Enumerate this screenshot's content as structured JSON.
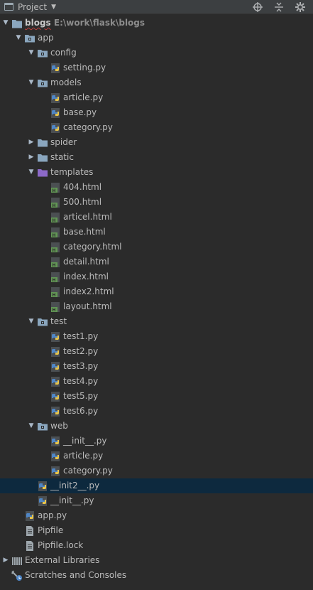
{
  "window": {
    "title": "Project"
  },
  "toolbar": {
    "icons": [
      "target-icon",
      "collapse-icon",
      "gear-icon"
    ]
  },
  "colors": {
    "background": "#2b2b2b",
    "header": "#3c3f41",
    "selected_row": "#0d293e",
    "folder": "#8aa6be",
    "python_blue": "#4f86c6",
    "python_yellow": "#e8c44a",
    "html_green": "#629755",
    "templates_folder": "#8c69c8"
  },
  "tree": [
    {
      "label": "blogs",
      "path": "E:\\work\\flask\\blogs",
      "depth": 0,
      "type": "root",
      "expanded": true
    },
    {
      "label": "app",
      "depth": 1,
      "type": "pkg",
      "expanded": true
    },
    {
      "label": "config",
      "depth": 2,
      "type": "pkg",
      "expanded": true
    },
    {
      "label": "setting.py",
      "depth": 3,
      "type": "py"
    },
    {
      "label": "models",
      "depth": 2,
      "type": "pkg",
      "expanded": true
    },
    {
      "label": "article.py",
      "depth": 3,
      "type": "py"
    },
    {
      "label": "base.py",
      "depth": 3,
      "type": "py"
    },
    {
      "label": "category.py",
      "depth": 3,
      "type": "py"
    },
    {
      "label": "spider",
      "depth": 2,
      "type": "folder",
      "expanded": false
    },
    {
      "label": "static",
      "depth": 2,
      "type": "folder",
      "expanded": false
    },
    {
      "label": "templates",
      "depth": 2,
      "type": "tplfolder",
      "expanded": true
    },
    {
      "label": "404.html",
      "depth": 3,
      "type": "html"
    },
    {
      "label": "500.html",
      "depth": 3,
      "type": "html"
    },
    {
      "label": "articel.html",
      "depth": 3,
      "type": "html"
    },
    {
      "label": "base.html",
      "depth": 3,
      "type": "html"
    },
    {
      "label": "category.html",
      "depth": 3,
      "type": "html"
    },
    {
      "label": "detail.html",
      "depth": 3,
      "type": "html"
    },
    {
      "label": "index.html",
      "depth": 3,
      "type": "html"
    },
    {
      "label": "index2.html",
      "depth": 3,
      "type": "html"
    },
    {
      "label": "layout.html",
      "depth": 3,
      "type": "html"
    },
    {
      "label": "test",
      "depth": 2,
      "type": "pkg",
      "expanded": true
    },
    {
      "label": "test1.py",
      "depth": 3,
      "type": "py"
    },
    {
      "label": "test2.py",
      "depth": 3,
      "type": "py"
    },
    {
      "label": "test3.py",
      "depth": 3,
      "type": "py"
    },
    {
      "label": "test4.py",
      "depth": 3,
      "type": "py"
    },
    {
      "label": "test5.py",
      "depth": 3,
      "type": "py"
    },
    {
      "label": "test6.py",
      "depth": 3,
      "type": "py"
    },
    {
      "label": "web",
      "depth": 2,
      "type": "pkg",
      "expanded": true
    },
    {
      "label": "__init__.py",
      "depth": 3,
      "type": "py"
    },
    {
      "label": "article.py",
      "depth": 3,
      "type": "py"
    },
    {
      "label": "category.py",
      "depth": 3,
      "type": "py"
    },
    {
      "label": "__init2__.py",
      "depth": 2,
      "type": "py",
      "selected": true
    },
    {
      "label": "__init__.py",
      "depth": 2,
      "type": "py"
    },
    {
      "label": "app.py",
      "depth": 1,
      "type": "py"
    },
    {
      "label": "Pipfile",
      "depth": 1,
      "type": "file"
    },
    {
      "label": "Pipfile.lock",
      "depth": 1,
      "type": "file"
    },
    {
      "label": "External Libraries",
      "depth": 0,
      "type": "libs",
      "expanded": false
    },
    {
      "label": "Scratches and Consoles",
      "depth": 0,
      "type": "scratch"
    }
  ]
}
